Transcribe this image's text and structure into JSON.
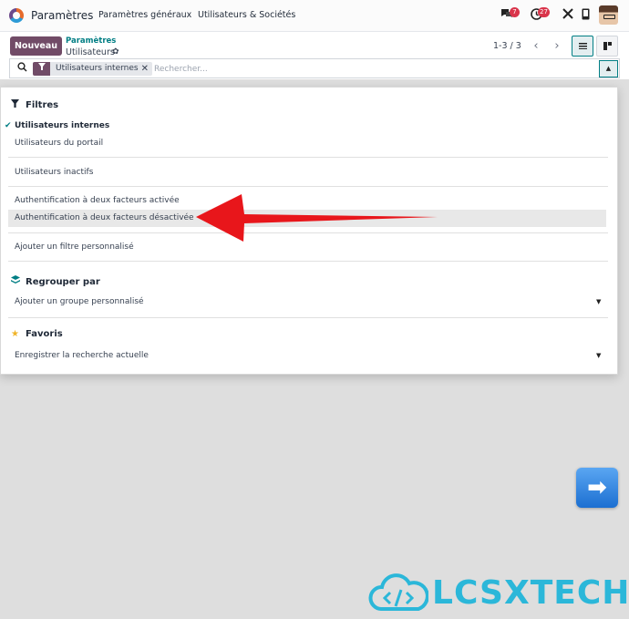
{
  "topbar": {
    "app_title": "Paramètres",
    "nav": [
      "Paramètres généraux",
      "Utilisateurs & Sociétés"
    ],
    "chat_badge": "7",
    "activity_badge": "27"
  },
  "control": {
    "new_button": "Nouveau",
    "breadcrumb_parent": "Paramètres",
    "breadcrumb_current": "Utilisateurs",
    "pager": "1-3 / 3"
  },
  "search": {
    "facet_value": "Utilisateurs internes",
    "placeholder": "Rechercher..."
  },
  "filters_panel": {
    "filters_title": "Filtres",
    "filters": [
      {
        "label": "Utilisateurs internes",
        "checked": true
      },
      {
        "label": "Utilisateurs du portail",
        "checked": false
      },
      {
        "label": "Utilisateurs inactifs",
        "checked": false
      },
      {
        "label": "Authentification à deux facteurs activée",
        "checked": false
      },
      {
        "label": "Authentification à deux facteurs désactivée",
        "checked": false,
        "highlighted": true
      },
      {
        "label": "Ajouter un filtre personnalisé",
        "checked": false
      }
    ],
    "groupby_title": "Regrouper par",
    "groupby_custom": "Ajouter un groupe personnalisé",
    "favorites_title": "Favoris",
    "favorites_save": "Enregistrer la recherche actuelle"
  },
  "annotation": {
    "arrow_color": "#e8161b"
  },
  "watermark": {
    "text": "LCSXTECH",
    "color": "#2bb7d9"
  },
  "colors": {
    "brand": "#714b67",
    "accent": "#017e84",
    "badge": "#d9344a"
  }
}
